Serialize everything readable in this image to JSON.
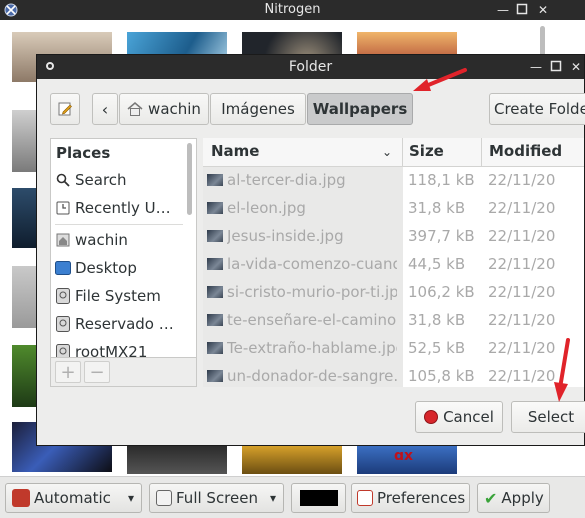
{
  "nitrogen": {
    "title": "Nitrogen",
    "bottom_bar": {
      "mode_label": "Automatic",
      "display_label": "Full Screen",
      "color_value": "#000000",
      "preferences_label": "Preferences",
      "apply_label": "Apply"
    }
  },
  "dialog": {
    "title": "Folder",
    "path": {
      "segment_1": "wachin",
      "segment_2": "Imágenes",
      "segment_3": "Wallpapers"
    },
    "create_folder_label": "Create Folder",
    "sidebar": {
      "header": "Places",
      "items": [
        {
          "label": "Search",
          "icon": "search-icon"
        },
        {
          "label": "Recently Used",
          "icon": "recent-icon"
        },
        {
          "label": "wachin",
          "icon": "home-icon"
        },
        {
          "label": "Desktop",
          "icon": "desktop-icon"
        },
        {
          "label": "File System",
          "icon": "drive-icon"
        },
        {
          "label": "Reservado para el sistema",
          "icon": "drive-icon"
        },
        {
          "label": "rootMX21",
          "icon": "drive-icon"
        }
      ]
    },
    "columns": {
      "name": "Name",
      "size": "Size",
      "modified": "Modified"
    },
    "files": [
      {
        "name": "al-tercer-dia.jpg",
        "size": "118,1 kB",
        "modified": "22/11/20"
      },
      {
        "name": "el-leon.jpg",
        "size": "31,8 kB",
        "modified": "22/11/20"
      },
      {
        "name": "Jesus-inside.jpg",
        "size": "397,7 kB",
        "modified": "22/11/20"
      },
      {
        "name": "la-vida-comenzo-cuando.jpg",
        "size": "44,5 kB",
        "modified": "22/11/20"
      },
      {
        "name": "si-cristo-murio-por-ti.jpg",
        "size": "106,2 kB",
        "modified": "22/11/20"
      },
      {
        "name": "te-enseñare-el-camino.jpg",
        "size": "31,8 kB",
        "modified": "22/11/20"
      },
      {
        "name": "Te-extraño-hablame.jpg",
        "size": "52,5 kB",
        "modified": "22/11/20"
      },
      {
        "name": "un-donador-de-sangre.jpg",
        "size": "105,8 kB",
        "modified": "22/11/20"
      }
    ],
    "cancel_label": "Cancel",
    "select_label": "Select"
  },
  "colors": {
    "titlebar": "#2b2b2b",
    "arrow": "#e0232a",
    "selected_segment": "#c9cacb"
  }
}
